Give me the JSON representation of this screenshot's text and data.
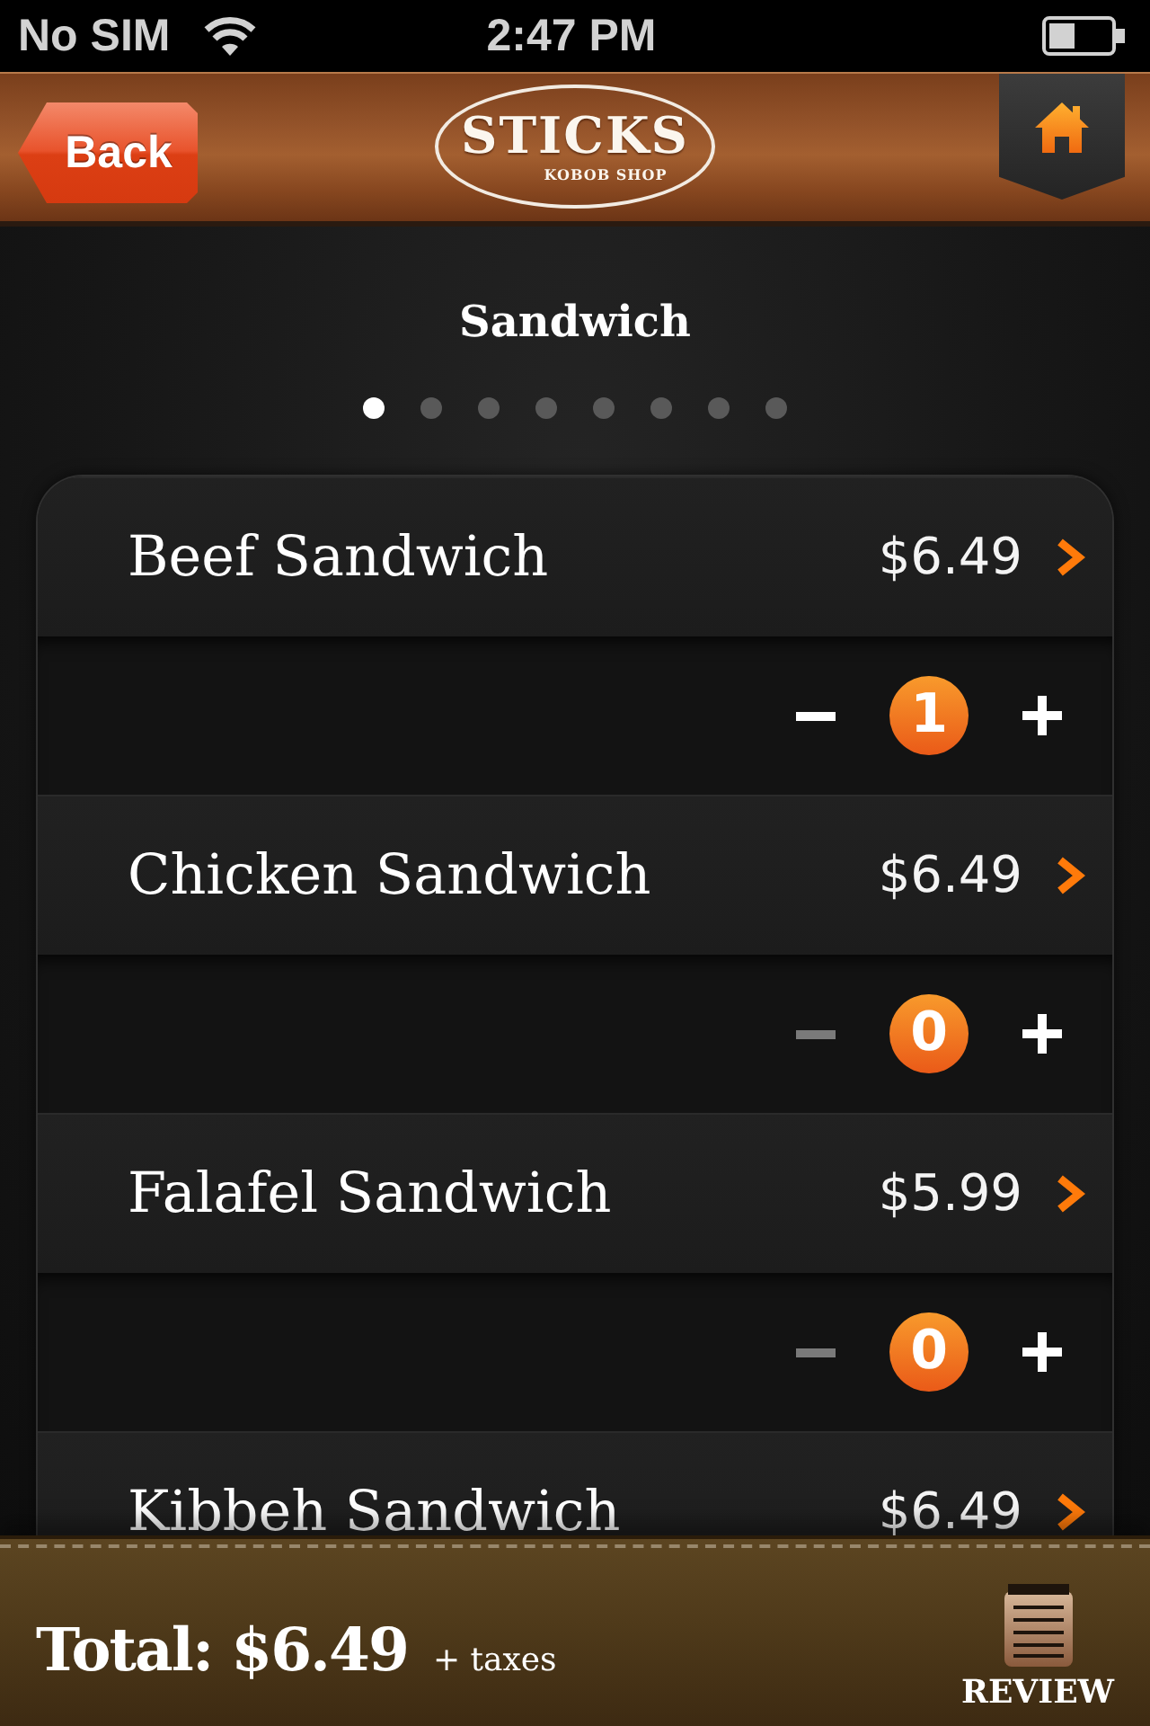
{
  "status_bar": {
    "carrier": "No SIM",
    "time": "2:47 PM"
  },
  "nav_bar": {
    "back_button": "Back",
    "logo": {
      "wordmark": "STICKS",
      "tagline": "KOBOB SHOP"
    }
  },
  "category": {
    "title": "Sandwich",
    "pages": [
      {
        "selected": true
      },
      {
        "selected": false
      },
      {
        "selected": false
      },
      {
        "selected": false
      },
      {
        "selected": false
      },
      {
        "selected": false
      },
      {
        "selected": false
      },
      {
        "selected": false
      }
    ]
  },
  "items": [
    {
      "name": "Beef Sandwich",
      "price": "$6.49",
      "quantity": "1",
      "decrease_disabled": false
    },
    {
      "name": "Chicken Sandwich",
      "price": "$6.49",
      "quantity": "0",
      "decrease_disabled": true
    },
    {
      "name": "Falafel Sandwich",
      "price": "$5.99",
      "quantity": "0",
      "decrease_disabled": true
    },
    {
      "name": "Kibbeh Sandwich",
      "price": "$6.49"
    }
  ],
  "footer": {
    "total": "Total: $6.49",
    "taxes_note": "+ taxes",
    "review_button": "REVIEW"
  }
}
